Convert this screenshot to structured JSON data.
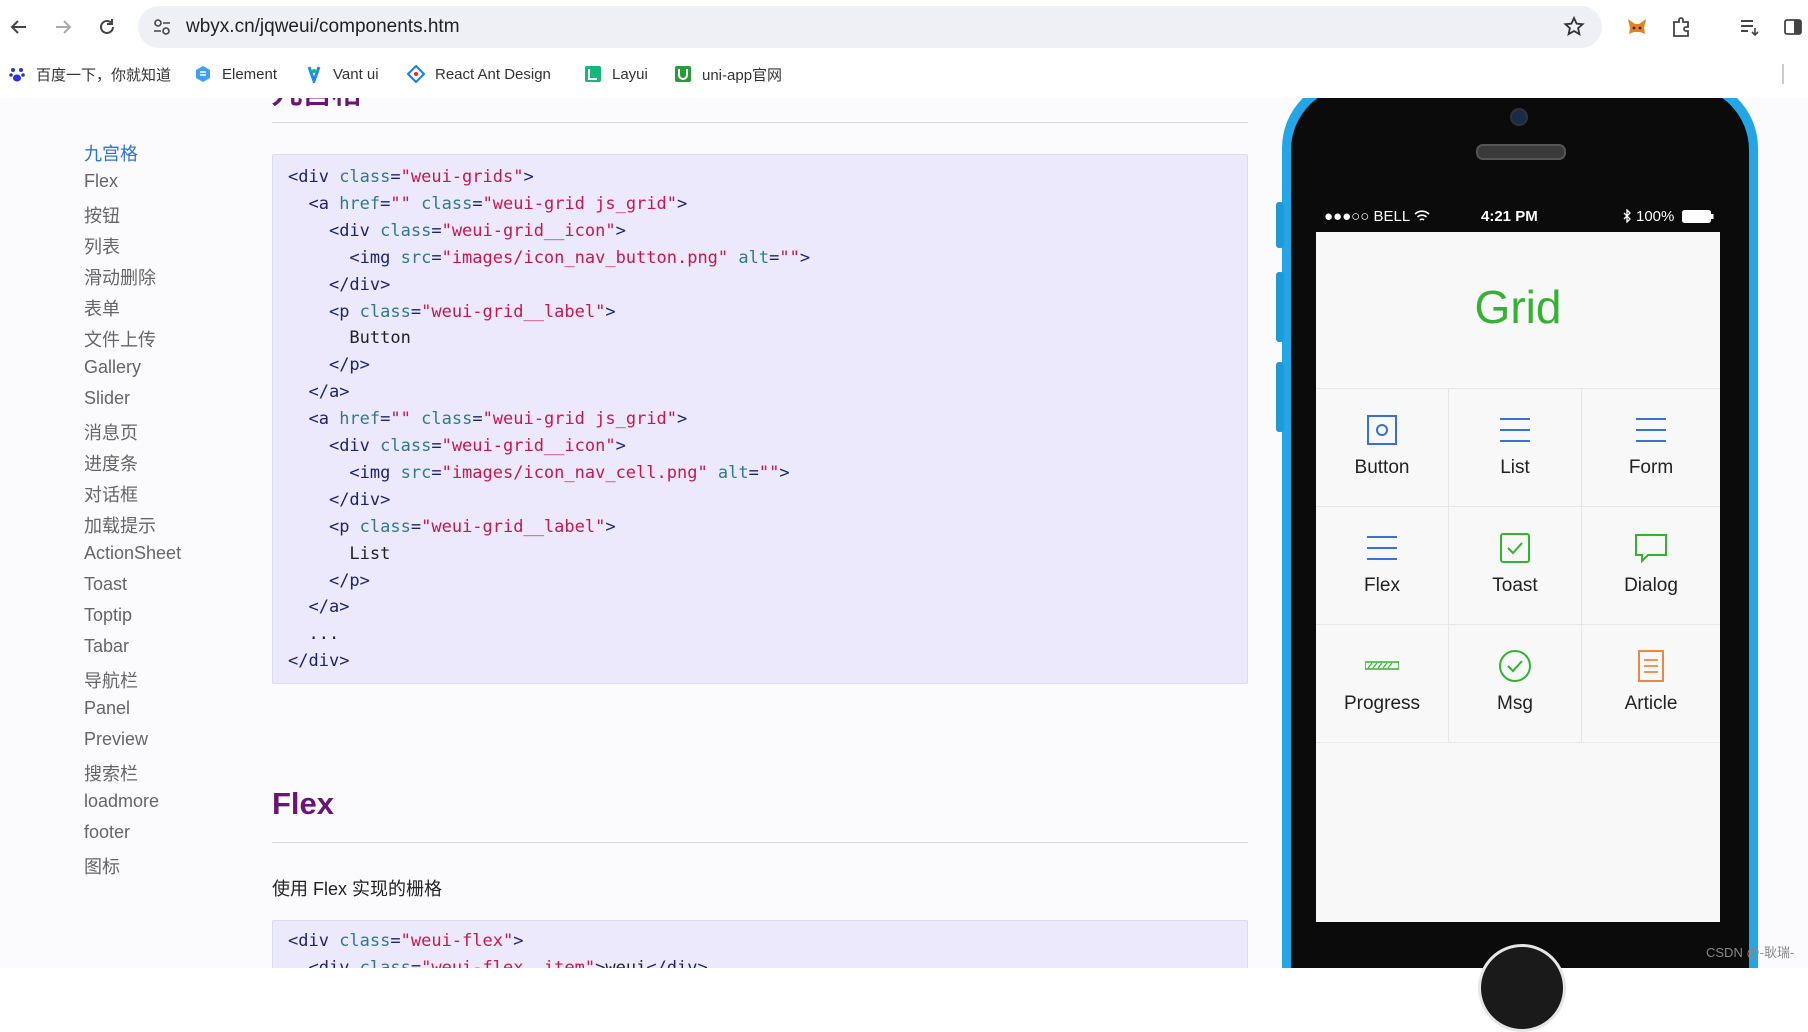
{
  "browser": {
    "url": "wbyx.cn/jqweui/components.htm",
    "bookmarks": [
      {
        "label": "百度一下，你就知道",
        "icon": "baidu-icon"
      },
      {
        "label": "Element",
        "icon": "element-icon"
      },
      {
        "label": "Vant ui",
        "icon": "vant-icon"
      },
      {
        "label": "React Ant Design",
        "icon": "antd-icon"
      },
      {
        "label": "Layui",
        "icon": "layui-icon"
      },
      {
        "label": "uni-app官网",
        "icon": "uniapp-icon"
      }
    ]
  },
  "sidebar": {
    "items": [
      "九宫格",
      "Flex",
      "按钮",
      "列表",
      "滑动删除",
      "表单",
      "文件上传",
      "Gallery",
      "Slider",
      "消息页",
      "进度条",
      "对话框",
      "加载提示",
      "ActionSheet",
      "Toast",
      "Toptip",
      "Tabar",
      "导航栏",
      "Panel",
      "Preview",
      "搜索栏",
      "loadmore",
      "footer",
      "图标"
    ]
  },
  "content": {
    "section1_title": "九宫格",
    "code1": [
      "<div class=\"weui-grids\">",
      "  <a href=\"\" class=\"weui-grid js_grid\">",
      "    <div class=\"weui-grid__icon\">",
      "      <img src=\"images/icon_nav_button.png\" alt=\"\">",
      "    </div>",
      "    <p class=\"weui-grid__label\">",
      "      Button",
      "    </p>",
      "  </a>",
      "  <a href=\"\" class=\"weui-grid js_grid\">",
      "    <div class=\"weui-grid__icon\">",
      "      <img src=\"images/icon_nav_cell.png\" alt=\"\">",
      "    </div>",
      "    <p class=\"weui-grid__label\">",
      "      List",
      "    </p>",
      "  </a>",
      "  ...",
      "</div>"
    ],
    "section2_title": "Flex",
    "section2_desc": "使用 Flex 实现的栅格",
    "code2": [
      "<div class=\"weui-flex\">",
      "  <div class=\"weui-flex__item\">weui</div>"
    ]
  },
  "phone": {
    "status": {
      "carrier": "●●●○○ BELL",
      "time": "4:21 PM",
      "battery": "100%"
    },
    "title": "Grid",
    "grid": [
      {
        "label": "Button",
        "icon": "button-icon"
      },
      {
        "label": "List",
        "icon": "list-icon"
      },
      {
        "label": "Form",
        "icon": "form-icon"
      },
      {
        "label": "Flex",
        "icon": "flex-icon"
      },
      {
        "label": "Toast",
        "icon": "toast-icon"
      },
      {
        "label": "Dialog",
        "icon": "dialog-icon"
      },
      {
        "label": "Progress",
        "icon": "progress-icon"
      },
      {
        "label": "Msg",
        "icon": "msg-icon"
      },
      {
        "label": "Article",
        "icon": "article-icon"
      }
    ],
    "colors": {
      "accent": "#34b233",
      "icon_blue": "#3a6fd8",
      "icon_orange": "#f0883a",
      "frame": "#23a6e8"
    }
  },
  "watermark": "CSDN @-耿瑞-"
}
